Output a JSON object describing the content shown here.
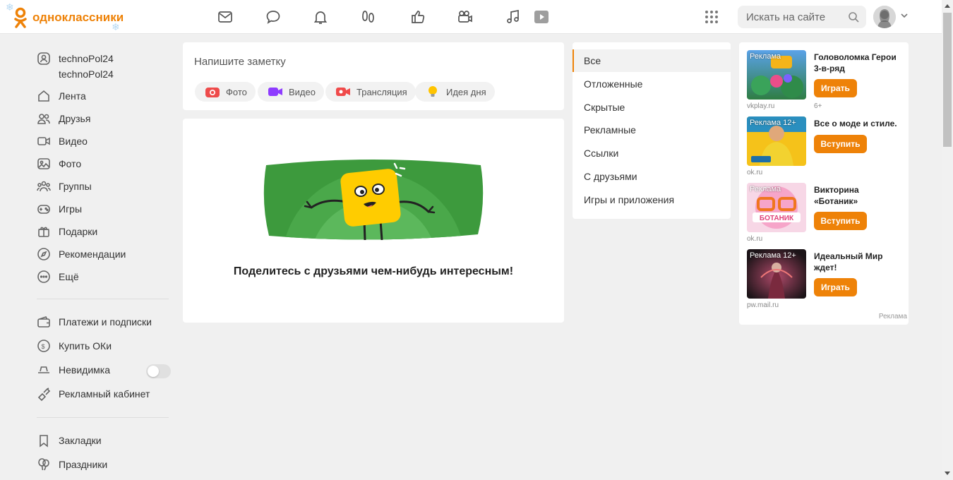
{
  "header": {
    "logo_text": "одноклассники",
    "nav_icons": [
      "messages-icon",
      "discussions-icon",
      "notifications-icon",
      "guests-icon",
      "likes-icon",
      "video-icon",
      "music-icon",
      "video-play-icon"
    ],
    "search_placeholder": "Искать на сайте"
  },
  "sidebar": {
    "user_name": "technoPol24",
    "user_login": "technoPol24",
    "items": [
      {
        "label": "Лента",
        "icon": "feed-icon"
      },
      {
        "label": "Друзья",
        "icon": "friends-icon"
      },
      {
        "label": "Видео",
        "icon": "video-icon"
      },
      {
        "label": "Фото",
        "icon": "photo-icon"
      },
      {
        "label": "Группы",
        "icon": "groups-icon"
      },
      {
        "label": "Игры",
        "icon": "games-icon"
      },
      {
        "label": "Подарки",
        "icon": "gifts-icon"
      },
      {
        "label": "Рекомендации",
        "icon": "recommendations-icon"
      },
      {
        "label": "Ещё",
        "icon": "more-icon"
      }
    ],
    "services": [
      {
        "label": "Платежи и подписки",
        "icon": "wallet-icon"
      },
      {
        "label": "Купить ОКи",
        "icon": "coin-icon"
      },
      {
        "label": "Невидимка",
        "icon": "invisible-icon",
        "toggle": false
      },
      {
        "label": "Рекламный кабинет",
        "icon": "megaphone-icon"
      }
    ],
    "extras": [
      {
        "label": "Закладки",
        "icon": "bookmark-icon"
      },
      {
        "label": "Праздники",
        "icon": "balloons-icon"
      }
    ]
  },
  "composer": {
    "placeholder": "Напишите заметку",
    "chips": [
      {
        "label": "Фото",
        "icon": "camera-icon"
      },
      {
        "label": "Видео",
        "icon": "video-camera-icon"
      },
      {
        "label": "Трансляция",
        "icon": "broadcast-icon"
      },
      {
        "label": "Идея дня",
        "icon": "lightbulb-icon"
      }
    ]
  },
  "feed": {
    "empty_message": "Поделитесь с друзьями чем-нибудь интересным!"
  },
  "filters": {
    "items": [
      "Все",
      "Отложенные",
      "Скрытые",
      "Рекламные",
      "Ссылки",
      "С друзьями",
      "Игры и приложения"
    ],
    "active": "Все"
  },
  "ads": {
    "items": [
      {
        "badge": "Реклама",
        "title": "Головоломка Герои 3-в-ряд",
        "button": "Играть",
        "source": "vkplay.ru",
        "age": "6+"
      },
      {
        "badge": "Реклама 12+",
        "title": "Все о моде и стиле.",
        "button": "Вступить",
        "source": "ok.ru",
        "age": ""
      },
      {
        "badge": "Реклама",
        "title": "Викторина «Ботаник»",
        "button": "Вступить",
        "source": "ok.ru",
        "age": ""
      },
      {
        "badge": "Реклама 12+",
        "title": "Идеальный Мир ждет!",
        "button": "Играть",
        "source": "pw.mail.ru",
        "age": ""
      }
    ],
    "footer": "Реклама"
  },
  "colors": {
    "brand": "#ee8208",
    "page_bg": "#f0f0f0"
  }
}
